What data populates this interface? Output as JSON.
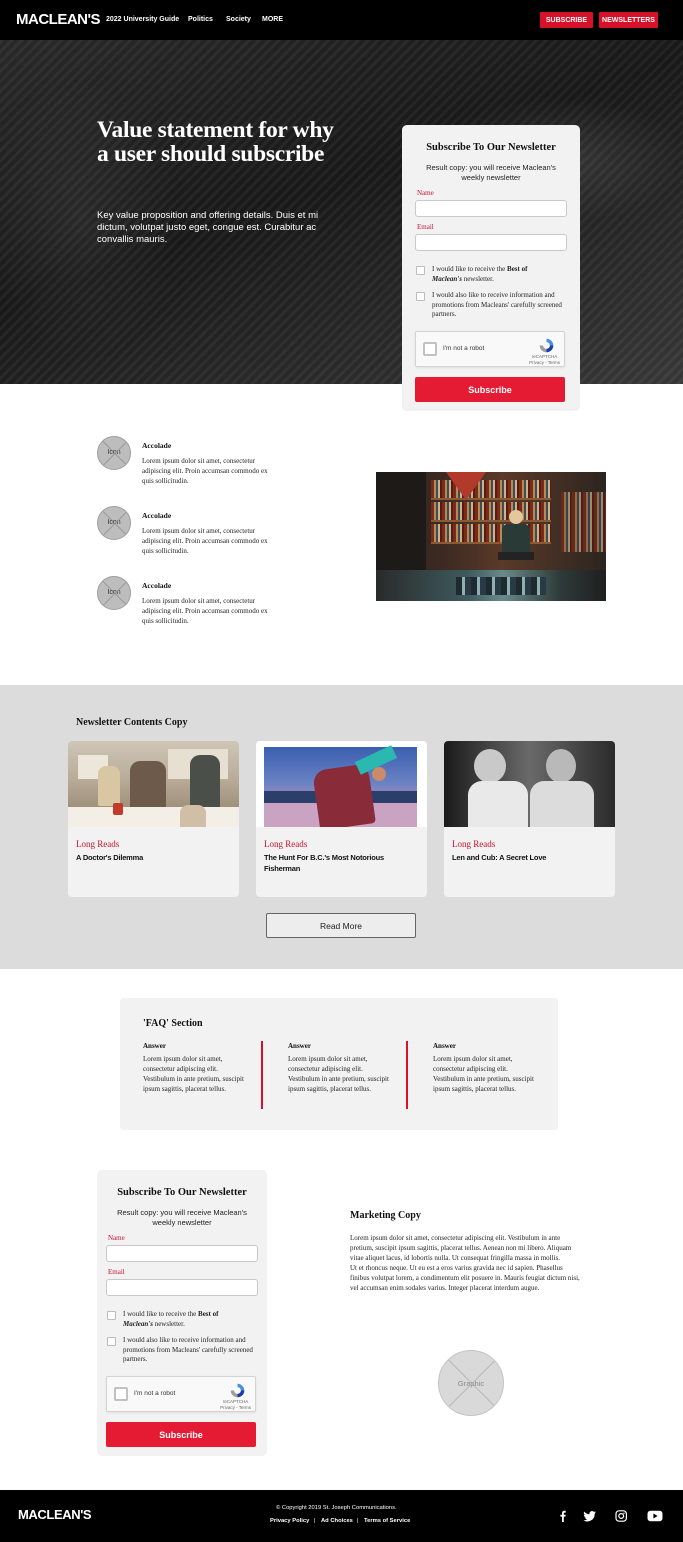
{
  "header": {
    "logo": "MACLEAN'S",
    "nav": [
      "2022 University Guide",
      "Politics",
      "Society",
      "MORE"
    ],
    "subscribe": "SUBSCRIBE",
    "newsletters": "NEWSLETTERS"
  },
  "hero": {
    "title": "Value statement for why a user should subscribe",
    "body": "Key value proposition and offering details. Duis et mi dictum, volutpat justo eget, congue est. Curabitur ac convallis mauris."
  },
  "signup": {
    "title": "Subscribe To Our Newsletter",
    "copy": "Result copy: you will receive Maclean's weekly newsletter",
    "name_label": "Name",
    "email_label": "Email",
    "check1_pre": "I would like to receive the ",
    "check1_bold": "Best of",
    "check1_italic": "Maclean's",
    "check1_post": " newsletter.",
    "check2": "I would also like to receive information and promotions from Macleans' carefully screened partners.",
    "captcha_text": "I'm not a robot",
    "captcha_brand": "reCAPTCHA",
    "captcha_links": "Privacy - Terms",
    "button": "Subscribe"
  },
  "accolades": [
    {
      "icon": "Icon",
      "title": "Accolade",
      "text": "Lorem ipsum dolor sit amet, consectetur adipiscing elit. Proin accumsan commodo ex quis sollicitudin."
    },
    {
      "icon": "Icon",
      "title": "Accolade",
      "text": "Lorem ipsum dolor sit amet, consectetur adipiscing elit. Proin accumsan commodo ex quis sollicitudin."
    },
    {
      "icon": "Icon",
      "title": "Accolade",
      "text": "Lorem ipsum dolor sit amet, consectetur adipiscing elit. Proin accumsan commodo ex quis sollicitudin."
    }
  ],
  "contents": {
    "title": "Newsletter Contents Copy",
    "cards": [
      {
        "category": "Long Reads",
        "headline": "A Doctor's Dilemma"
      },
      {
        "category": "Long Reads",
        "headline": "The Hunt For B.C.'s Most Notorious Fisherman"
      },
      {
        "category": "Long Reads",
        "headline": "Len and Cub: A Secret Love"
      }
    ],
    "read_more": "Read More"
  },
  "faq": {
    "title": "'FAQ' Section",
    "items": [
      {
        "heading": "Answer",
        "text": "Lorem ipsum dolor sit amet, consectetur adipiscing elit. Vestibulum in ante pretium, suscipit ipsum sagittis, placerat tellus."
      },
      {
        "heading": "Answer",
        "text": "Lorem ipsum dolor sit amet, consectetur adipiscing elit. Vestibulum in ante pretium, suscipit ipsum sagittis, placerat tellus."
      },
      {
        "heading": "Answer",
        "text": "Lorem ipsum dolor sit amet, consectetur adipiscing elit. Vestibulum in ante pretium, suscipit ipsum sagittis, placerat tellus."
      }
    ]
  },
  "marketing": {
    "title": "Marketing Copy",
    "para1": "Lorem ipsum dolor sit amet, consectetur adipiscing elit. Vestibulum in ante pretium, suscipit ipsum sagittis, placerat tellus. Aenean non mi libero. Aliquam vitae aliquet lacus, id lobortis nulla. Ut consequat fringilla massa in mollis.",
    "para2": "Ut et rhoncus neque. Ut eu est a eros varius gravida nec id sapien. Phasellus finibus volutpat lorem, a condimentum elit posuere in. Mauris feugiat dictum nisi, vel accumsan enim sodales varius. Integer placerat interdum augue.",
    "graphic": "Graphic"
  },
  "footer": {
    "logo": "MACLEAN'S",
    "copyright": "© Copyright 2019 St. Joseph Communications.",
    "links": [
      "Privacy Policy",
      "Ad Choices",
      "Terms of Service"
    ],
    "separator": "|",
    "social": [
      "facebook-icon",
      "twitter-icon",
      "instagram-icon",
      "youtube-icon"
    ]
  },
  "colors": {
    "accent": "#d6112a",
    "header_bg": "#000000",
    "panel_bg": "#f2f2f2",
    "contents_bg": "#dcdcdc"
  }
}
